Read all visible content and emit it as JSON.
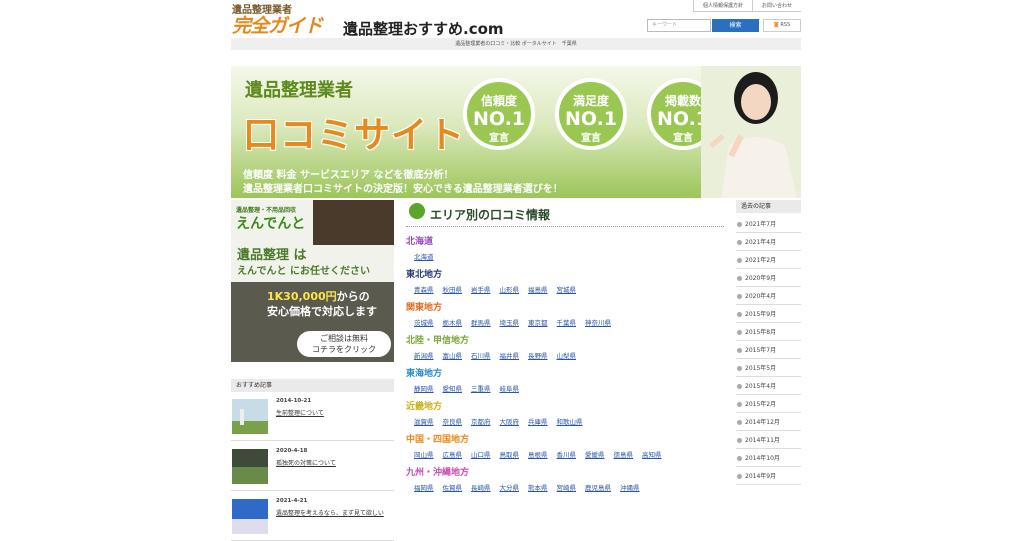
{
  "header": {
    "top_links": [
      "個人情報保護方針",
      "お問い合わせ"
    ],
    "logo_line1": "遺品整理業者",
    "logo_line2": "完全ガイド",
    "site_name": "遺品整理おすすめ.com",
    "search_placeholder": "キーワード",
    "search_button": "検索",
    "rss": "RSS",
    "tagline": "遺品整理業者の口コミ・比較 ポータルサイト　千葉県"
  },
  "banner": {
    "category": "遺品整理業者",
    "headline": "口コミサイト",
    "medals": [
      {
        "top": "信頼度",
        "num": "NO.1",
        "bottom": "宣言"
      },
      {
        "top": "満足度",
        "num": "NO.1",
        "bottom": "宣言"
      },
      {
        "top": "掲載数",
        "num": "NO.1",
        "bottom": "宣言"
      }
    ],
    "sub1": "信頼度 料金 サービスエリア などを徹底分析！",
    "sub2": "遺品整理業者口コミサイトの決定版！安心できる遺品整理業者選びを！"
  },
  "ad": {
    "small": "遺品整理・不用品回収",
    "brand": "えんでんと",
    "msg1": "遺品整理 は",
    "msg2": "えんでんと にお任せください",
    "price_highlight": "1K30,000円",
    "price_rest": "からの",
    "price2": "安心価格で対応します",
    "consult1": "ご相談は無料",
    "consult2": "コチラをクリック"
  },
  "recommended": {
    "heading": "おすすめ記事",
    "items": [
      {
        "date": "2014-10-21",
        "title": "生前整理について"
      },
      {
        "date": "2020-4-18",
        "title": "孤独死の対策について"
      },
      {
        "date": "2021-4-21",
        "title": "遺品整理を考えるなら、まず見て欲しい"
      }
    ]
  },
  "area": {
    "heading": "エリア別の口コミ情報",
    "regions": [
      {
        "name": "北海道",
        "color": "#9b44c4",
        "prefs": [
          "北海道"
        ]
      },
      {
        "name": "東北地方",
        "color": "#2a3a7a",
        "prefs": [
          "青森県",
          "秋田県",
          "岩手県",
          "山形県",
          "福島県",
          "宮城県"
        ]
      },
      {
        "name": "関東地方",
        "color": "#e36a1a",
        "prefs": [
          "茨城県",
          "栃木県",
          "群馬県",
          "埼玉県",
          "東京都",
          "千葉県",
          "神奈川県"
        ]
      },
      {
        "name": "北陸・甲信地方",
        "color": "#7aa63a",
        "prefs": [
          "新潟県",
          "富山県",
          "石川県",
          "福井県",
          "長野県",
          "山梨県"
        ]
      },
      {
        "name": "東海地方",
        "color": "#2a8ac8",
        "prefs": [
          "静岡県",
          "愛知県",
          "三重県",
          "岐阜県"
        ]
      },
      {
        "name": "近畿地方",
        "color": "#c8b21a",
        "prefs": [
          "滋賀県",
          "奈良県",
          "京都府",
          "大阪府",
          "兵庫県",
          "和歌山県"
        ]
      },
      {
        "name": "中国・四国地方",
        "color": "#e88a1a",
        "prefs": [
          "岡山県",
          "広島県",
          "山口県",
          "鳥取県",
          "島根県",
          "香川県",
          "愛媛県",
          "徳島県",
          "高知県"
        ]
      },
      {
        "name": "九州・沖縄地方",
        "color": "#c84ab2",
        "prefs": [
          "福岡県",
          "佐賀県",
          "長崎県",
          "大分県",
          "熊本県",
          "宮崎県",
          "鹿児島県",
          "沖縄県"
        ]
      }
    ]
  },
  "past": {
    "heading": "過去の記事",
    "items": [
      "2021年7月",
      "2021年4月",
      "2021年2月",
      "2020年9月",
      "2020年4月",
      "2015年9月",
      "2015年8月",
      "2015年7月",
      "2015年5月",
      "2015年4月",
      "2015年2月",
      "2014年12月",
      "2014年11月",
      "2014年10月",
      "2014年9月"
    ]
  }
}
